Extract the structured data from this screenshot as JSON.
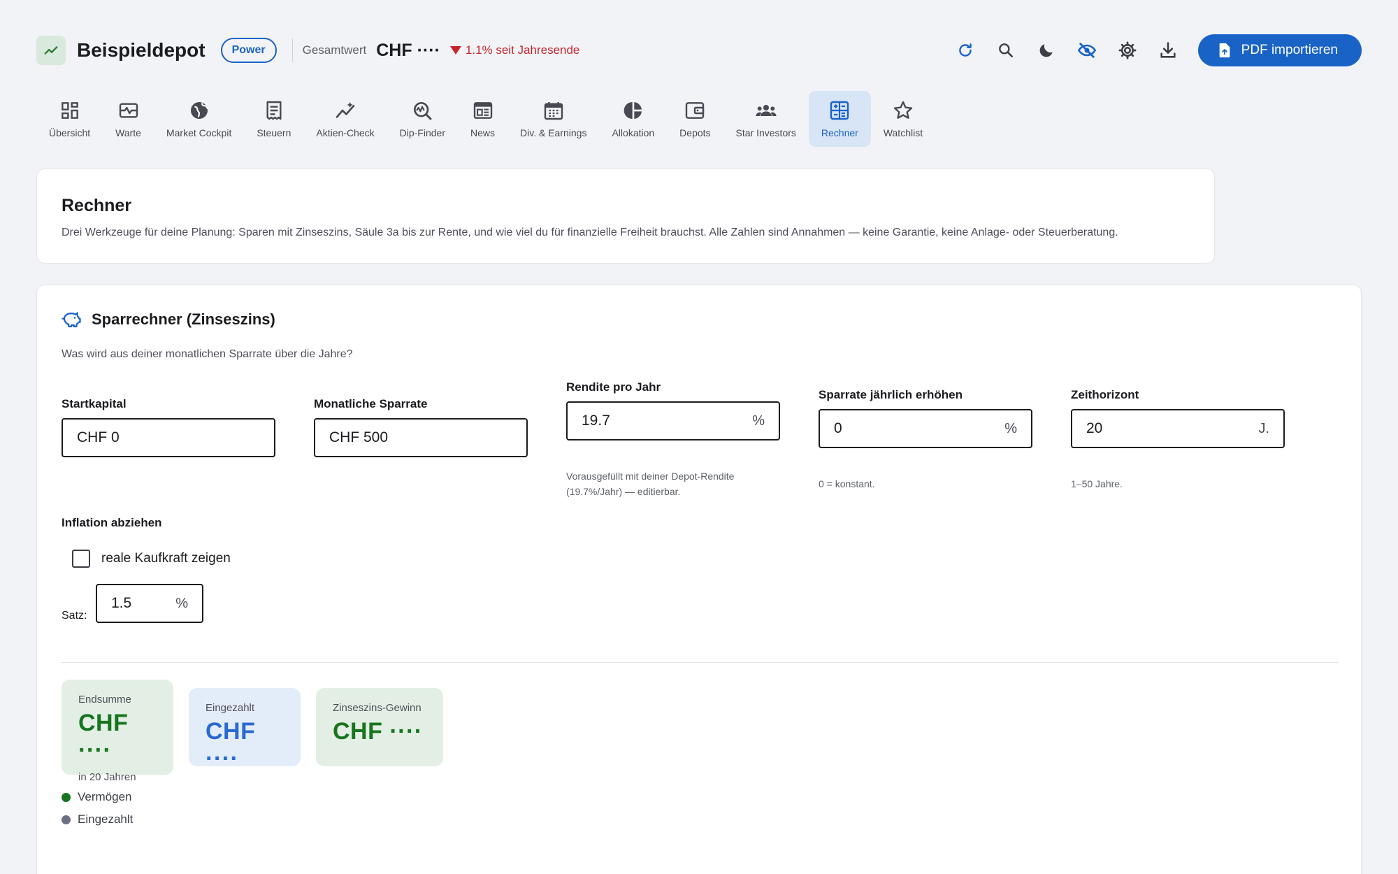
{
  "header": {
    "app_title": "Beispieldepot",
    "badge": "Power",
    "total_label": "Gesamtwert",
    "total_value": "CHF ····",
    "performance": "1.1% seit Jahresende",
    "pdf_button": "PDF importieren",
    "accent_color": "#1a63c6",
    "negative_color": "#c6262e"
  },
  "nav": {
    "tabs": [
      {
        "label": "Übersicht",
        "icon": "dashboard-icon"
      },
      {
        "label": "Warte",
        "icon": "monitor-heart-icon"
      },
      {
        "label": "Market Cockpit",
        "icon": "globe-icon"
      },
      {
        "label": "Steuern",
        "icon": "receipt-icon"
      },
      {
        "label": "Aktien-Check",
        "icon": "trending-icon"
      },
      {
        "label": "Dip-Finder",
        "icon": "query-stats-icon"
      },
      {
        "label": "News",
        "icon": "newspaper-icon"
      },
      {
        "label": "Div. & Earnings",
        "icon": "calendar-icon"
      },
      {
        "label": "Allokation",
        "icon": "pie-chart-icon"
      },
      {
        "label": "Depots",
        "icon": "wallet-icon"
      },
      {
        "label": "Star Investors",
        "icon": "groups-icon"
      },
      {
        "label": "Rechner",
        "icon": "calculator-icon"
      },
      {
        "label": "Watchlist",
        "icon": "star-icon"
      }
    ],
    "active": "Rechner"
  },
  "intro": {
    "title": "Rechner",
    "text": "Drei Werkzeuge für deine Planung: Sparen mit Zinseszins, Säule 3a bis zur Rente, und wie viel du für finanzielle Freiheit brauchst. Alle Zahlen sind Annahmen — keine Garantie, keine Anlage- oder Steuerberatung."
  },
  "calc": {
    "title": "Sparrechner (Zinseszins)",
    "subtitle": "Was wird aus deiner monatlichen Sparrate über die Jahre?",
    "fields": {
      "start": {
        "label": "Startkapital",
        "value": "CHF 0"
      },
      "monthly": {
        "label": "Monatliche Sparrate",
        "value": "CHF 500"
      },
      "return": {
        "label": "Rendite pro Jahr",
        "value": "19.7",
        "suffix": "%",
        "hint": "Vorausgefüllt mit deiner Depot-Rendite (19.7%/Jahr) — editierbar."
      },
      "increase": {
        "label": "Sparrate jährlich erhöhen",
        "value": "0",
        "suffix": "%",
        "hint": "0 = konstant."
      },
      "horizon": {
        "label": "Zeithorizont",
        "value": "20",
        "suffix": "J.",
        "hint": "1–50 Jahre."
      }
    },
    "inflation": {
      "label": "Inflation abziehen",
      "checkbox_label": "reale Kaufkraft zeigen",
      "checked": false,
      "rate_label": "Satz:",
      "rate_value": "1.5",
      "rate_suffix": "%"
    },
    "stats": {
      "end": {
        "label": "Endsumme",
        "value": "CHF ····",
        "note": "in 20 Jahren"
      },
      "paid": {
        "label": "Eingezahlt",
        "value": "CHF ····"
      },
      "gain": {
        "label": "Zinseszins-Gewinn",
        "value": "CHF ····"
      }
    },
    "legend": [
      {
        "label": "Vermögen",
        "color": "#17741f"
      },
      {
        "label": "Eingezahlt",
        "color": "#6b7080"
      }
    ]
  }
}
